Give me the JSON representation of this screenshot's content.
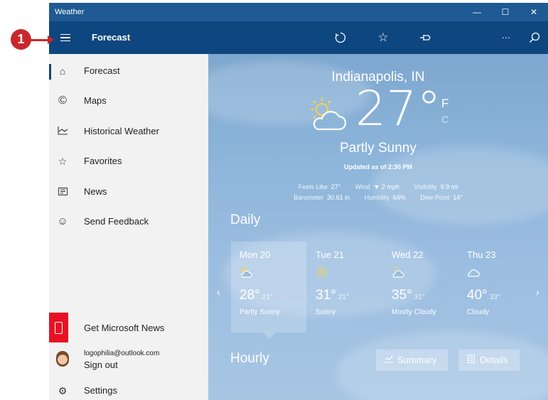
{
  "window": {
    "app_title": "Weather",
    "controls": [
      "—",
      "☐",
      "✕"
    ]
  },
  "header": {
    "title": "Forecast",
    "toolbar_icons": [
      "refresh-icon",
      "favorite-star-icon",
      "pin-icon",
      "dark-mode-moon-icon",
      "more-icon",
      "search-icon"
    ],
    "more_label": "···"
  },
  "sidebar": {
    "items": [
      {
        "label": "Forecast",
        "icon": "home-icon"
      },
      {
        "label": "Maps",
        "icon": "maps-icon"
      },
      {
        "label": "Historical Weather",
        "icon": "chart-icon"
      },
      {
        "label": "Favorites",
        "icon": "favorites-icon"
      },
      {
        "label": "News",
        "icon": "news-icon"
      },
      {
        "label": "Send Feedback",
        "icon": "smiley-icon"
      }
    ],
    "get_news": "Get Microsoft News",
    "account_email": "logophilia@outlook.com",
    "sign_out": "Sign out",
    "settings": "Settings"
  },
  "weather": {
    "city": "Indianapolis, IN",
    "temperature": "27°",
    "unit_f": "F",
    "unit_c": "C",
    "condition": "Partly Sunny",
    "updated": "Updated as of 2:30 PM",
    "details1": [
      {
        "label": "Feels Like",
        "value": "27°"
      },
      {
        "label": "Wind",
        "value": "▼ 2 mph"
      },
      {
        "label": "Visibility",
        "value": "9.9 mi"
      }
    ],
    "details2": [
      {
        "label": "Barometer",
        "value": "30.61 in"
      },
      {
        "label": "Humidity",
        "value": "64%"
      },
      {
        "label": "Dew Point",
        "value": "14°"
      }
    ]
  },
  "daily": {
    "title": "Daily",
    "days": [
      {
        "day": "Mon 20",
        "high": "28°",
        "low": "21°",
        "cond": "Partly Sunny",
        "icon": "partly-sunny-icon"
      },
      {
        "day": "Tue 21",
        "high": "31°",
        "low": "21°",
        "cond": "Sunny",
        "icon": "sunny-icon"
      },
      {
        "day": "Wed 22",
        "high": "35°",
        "low": "31°",
        "cond": "Mostly Cloudy",
        "icon": "mostly-cloudy-icon"
      },
      {
        "day": "Thu 23",
        "high": "40°",
        "low": "33°",
        "cond": "Cloudy",
        "icon": "cloudy-icon"
      }
    ]
  },
  "hourly": {
    "title": "Hourly",
    "summary_btn": "Summary",
    "details_btn": "Details"
  },
  "callout": {
    "number": "1"
  }
}
